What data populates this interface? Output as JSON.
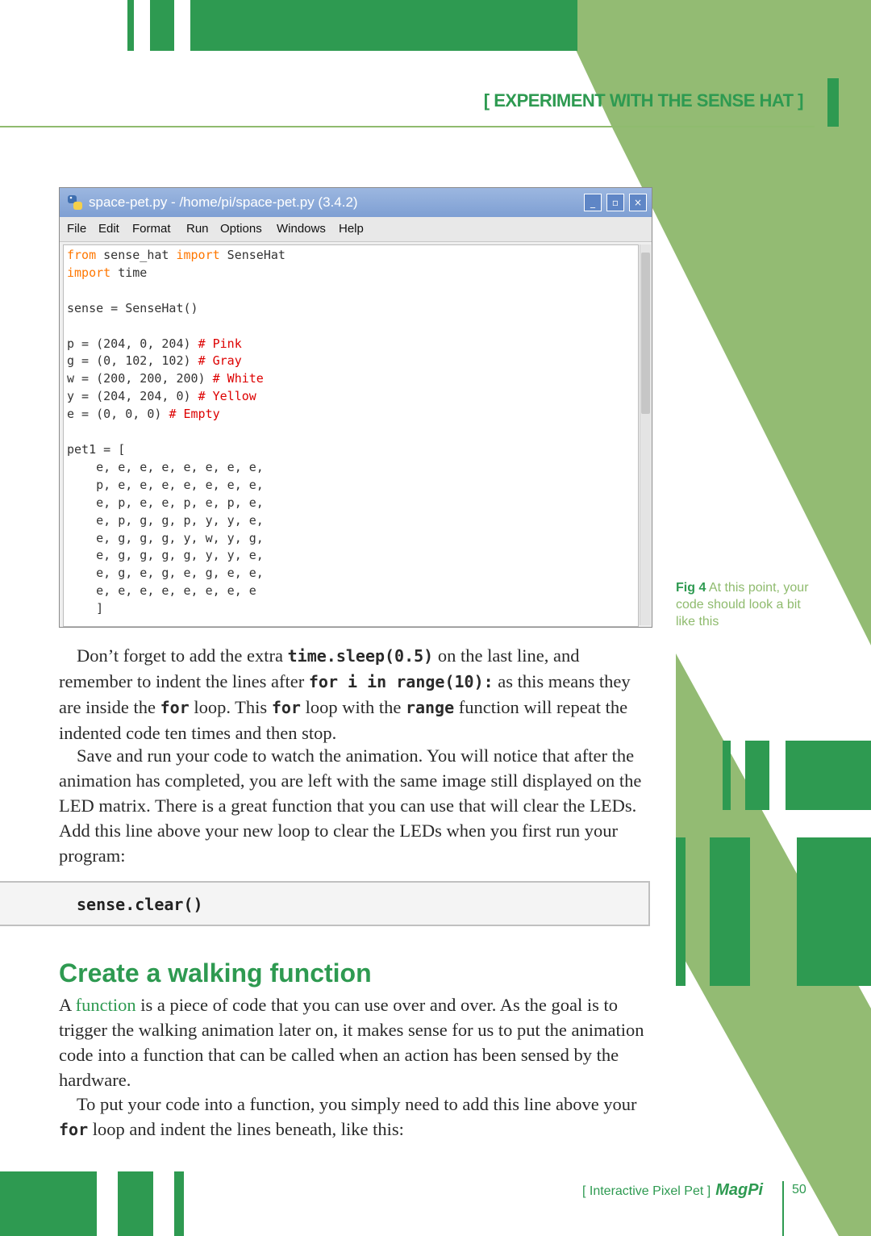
{
  "header": {
    "section_title": "[ EXPERIMENT WITH THE SENSE HAT ]"
  },
  "window": {
    "title": "space-pet.py - /home/pi/space-pet.py (3.4.2)",
    "buttons": {
      "minimize": "_",
      "maximize": "▫",
      "close": "×"
    },
    "menu": [
      "File",
      "Edit",
      "Format",
      "Run",
      "Options",
      "Windows",
      "Help"
    ]
  },
  "caption": {
    "fig": "Fig 4",
    "text": "At this point, your code should look a bit like this"
  },
  "body": {
    "p1_a": "Don’t forget to add the extra ",
    "p1_code1": "time.sleep(0.5)",
    "p1_b": " on the last line, and remember to indent the lines after ",
    "p1_code2": "for i in range(10):",
    "p1_c": " as this means they are inside the ",
    "p1_code3": "for",
    "p1_d": " loop. This ",
    "p1_code4": "for",
    "p1_e": " loop with the ",
    "p1_code5": "range",
    "p1_f": " function will repeat the indented code ten times and then stop.",
    "p2": "Save and run your code to watch the animation. You will notice that after the animation has completed, you are left with the same image still displayed on the LED matrix. There is a great function that you can use that will clear the LEDs. Add this line above your new loop to clear the LEDs when you first run your program:",
    "code_line": "sense.clear()",
    "heading": "Create a walking function",
    "p3_a": "A ",
    "p3_link": "function",
    "p3_b": " is a piece of code that you can use over and over. As the goal is to trigger the walking animation later on, it makes sense for us to put the animation code into a function that can be called when an action has been sensed by the hardware.",
    "p4_a": "To put your code into a function, you simply need to add this line above your ",
    "p4_code": "for",
    "p4_b": " loop and indent the lines beneath, like this:"
  },
  "footer": {
    "series": "[ Interactive Pixel Pet ]",
    "brand": "MagPi",
    "page": "50"
  }
}
